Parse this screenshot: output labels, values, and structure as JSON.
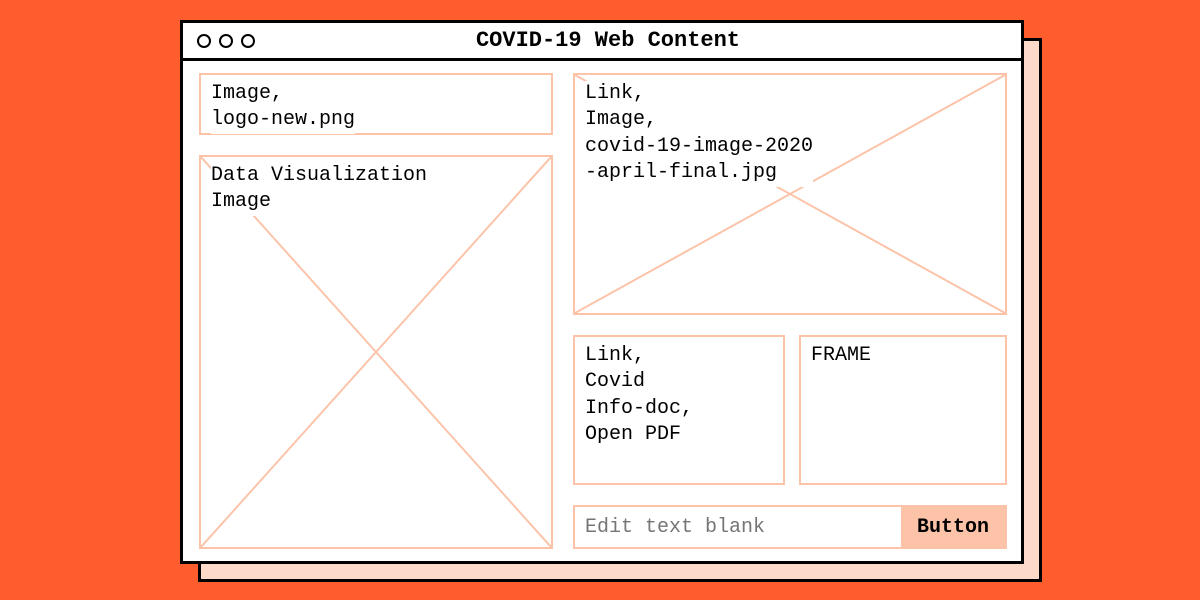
{
  "window": {
    "title": "COVID-19 Web Content"
  },
  "left": {
    "logo_box": "Image,\nlogo-new.png",
    "dataviz_box": "Data Visualization\nImage"
  },
  "right": {
    "hero_box": "Link,\nImage,\ncovid-19-image-2020\n-april-final.jpg",
    "doc_box": "Link,\nCovid\nInfo-doc,\nOpen PDF",
    "frame_box": "FRAME",
    "input_placeholder": "Edit text blank",
    "button_label": "Button"
  }
}
